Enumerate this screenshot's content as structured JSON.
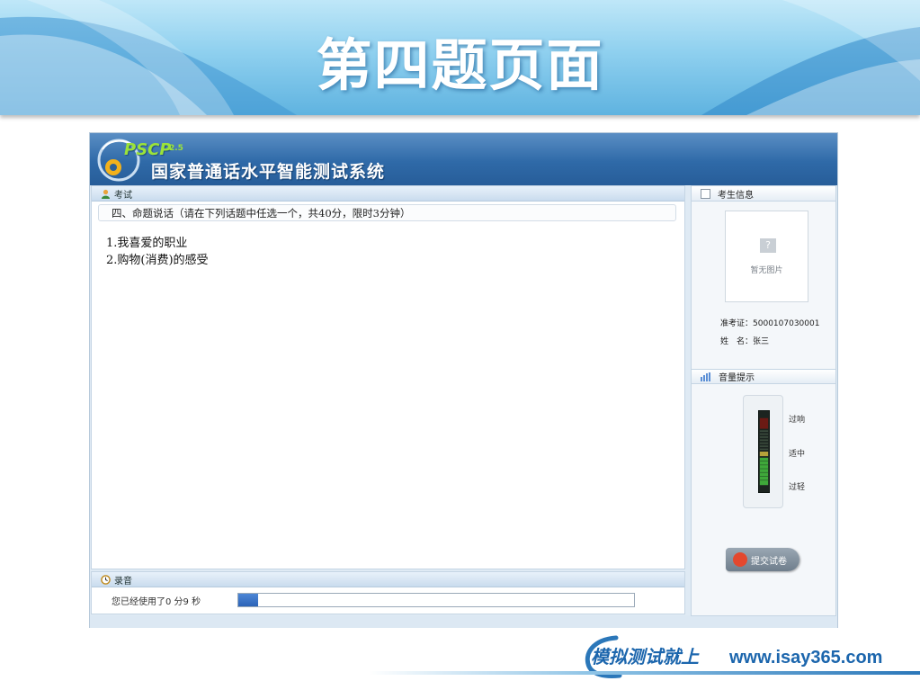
{
  "slide": {
    "title": "第四题页面"
  },
  "app": {
    "logo_text": "PSCP",
    "logo_version": "2.5",
    "name": "国家普通话水平智能测试系统"
  },
  "exam": {
    "panel_title": "考试",
    "question_heading": "四、命题说话（请在下列话题中任选一个，共40分，限时3分钟）",
    "topics": [
      "1.我喜爱的职业",
      "2.购物(消费)的感受"
    ]
  },
  "recording": {
    "panel_title": "录音",
    "elapsed_text": "您已经使用了0 分9 秒",
    "progress_fraction": 0.05
  },
  "candidate": {
    "panel_title": "考生信息",
    "photo_caption": "暂无图片",
    "ticket_label": "准考证：",
    "ticket_value": "5000107030001",
    "name_label": "姓　名：",
    "name_value": "张三"
  },
  "volume": {
    "panel_title": "音量提示",
    "labels": {
      "loud": "过响",
      "mid": "适中",
      "quiet": "过轻"
    }
  },
  "submit": {
    "label": "提交试卷"
  },
  "footer": {
    "brand_cn": "模拟测试就上",
    "brand_url": "www.isay365.com"
  },
  "colors": {
    "accent": "#2f6aa8",
    "brand": "#1c66ad",
    "meter_green": "#3fa83a",
    "meter_red": "#c0392b"
  }
}
